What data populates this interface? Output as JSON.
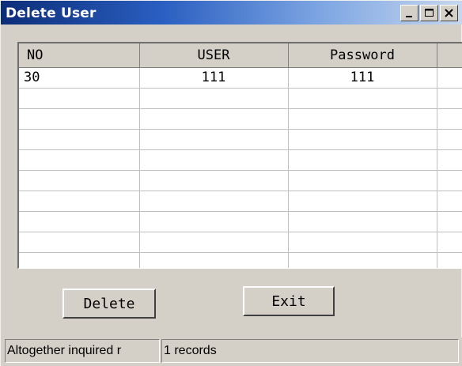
{
  "window": {
    "title": "Delete User"
  },
  "grid": {
    "columns": [
      "NO",
      "USER",
      "Password"
    ],
    "rows": [
      [
        "30",
        "111",
        "111"
      ],
      [
        "",
        "",
        ""
      ],
      [
        "",
        "",
        ""
      ],
      [
        "",
        "",
        ""
      ],
      [
        "",
        "",
        ""
      ],
      [
        "",
        "",
        ""
      ],
      [
        "",
        "",
        ""
      ],
      [
        "",
        "",
        ""
      ],
      [
        "",
        "",
        ""
      ],
      [
        "",
        "",
        ""
      ]
    ]
  },
  "buttons": {
    "delete": "Delete",
    "exit": "Exit"
  },
  "status": {
    "label": "Altogether inquired r",
    "count": "1 records"
  }
}
